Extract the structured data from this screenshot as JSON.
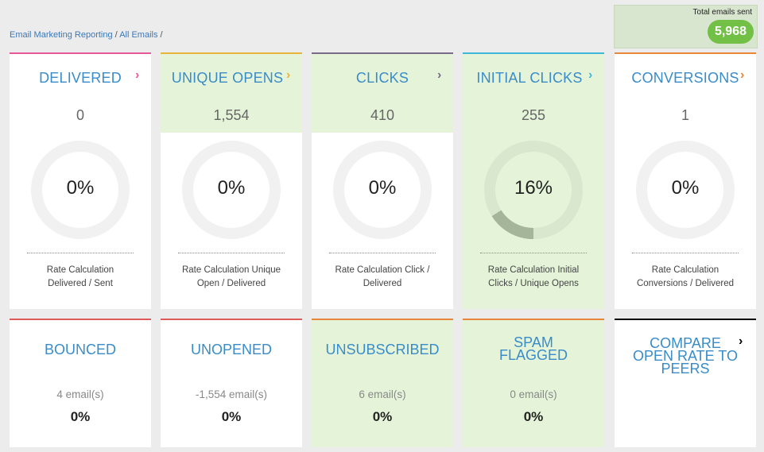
{
  "breadcrumb": {
    "root": "Email Marketing Reporting",
    "sep1": " / ",
    "current": "All Emails",
    "sep2": " /"
  },
  "total": {
    "label": "Total emails sent",
    "value": "5,968"
  },
  "colors": {
    "delivered": "#e8579a",
    "unique_opens": "#e8b53a",
    "clicks": "#7a6a8a",
    "initial_clicks": "#3fb8d8",
    "conversions": "#e8873a",
    "bounced": "#e05a5a",
    "unopened": "#e05a5a",
    "unsubscribed": "#e8873a",
    "spam": "#e8873a",
    "compare": "#000000",
    "green_bg": "#e5f4d9",
    "title_blue": "#3a8cc8"
  },
  "metrics": [
    {
      "title": "DELIVERED",
      "chevron": "›",
      "count": "0",
      "percent": "0%",
      "rate_line1": "Rate Calculation",
      "rate_line2": "Delivered / Sent",
      "fraction": 0
    },
    {
      "title": "UNIQUE OPENS",
      "chevron": "›",
      "count": "1,554",
      "percent": "0%",
      "rate_line1": "Rate Calculation Unique",
      "rate_line2": "Open / Delivered",
      "fraction": 0
    },
    {
      "title": "CLICKS",
      "chevron": "›",
      "count": "410",
      "percent": "0%",
      "rate_line1": "Rate Calculation Click /",
      "rate_line2": "Delivered",
      "fraction": 0
    },
    {
      "title": "INITIAL CLICKS",
      "chevron": "›",
      "count": "255",
      "percent": "16%",
      "rate_line1": "Rate Calculation Initial",
      "rate_line2": "Clicks / Unique Opens",
      "fraction": 0.16
    },
    {
      "title": "CONVERSIONS",
      "chevron": "›",
      "count": "1",
      "percent": "0%",
      "rate_line1": "Rate Calculation",
      "rate_line2": "Conversions / Delivered",
      "fraction": 0
    }
  ],
  "secondary": [
    {
      "title": "BOUNCED",
      "count": "4 email(s)",
      "percent": "0%"
    },
    {
      "title": "UNOPENED",
      "count": "-1,554 email(s)",
      "percent": "0%"
    },
    {
      "title": "UNSUBSCRIBED",
      "count": "6 email(s)",
      "percent": "0%"
    },
    {
      "title_line1": "SPAM",
      "title_line2": "FLAGGED",
      "count": "0 email(s)",
      "percent": "0%"
    },
    {
      "title_line1": "COMPARE",
      "title_line2": "OPEN RATE TO",
      "title_line3": "PEERS",
      "chevron": "›"
    }
  ]
}
